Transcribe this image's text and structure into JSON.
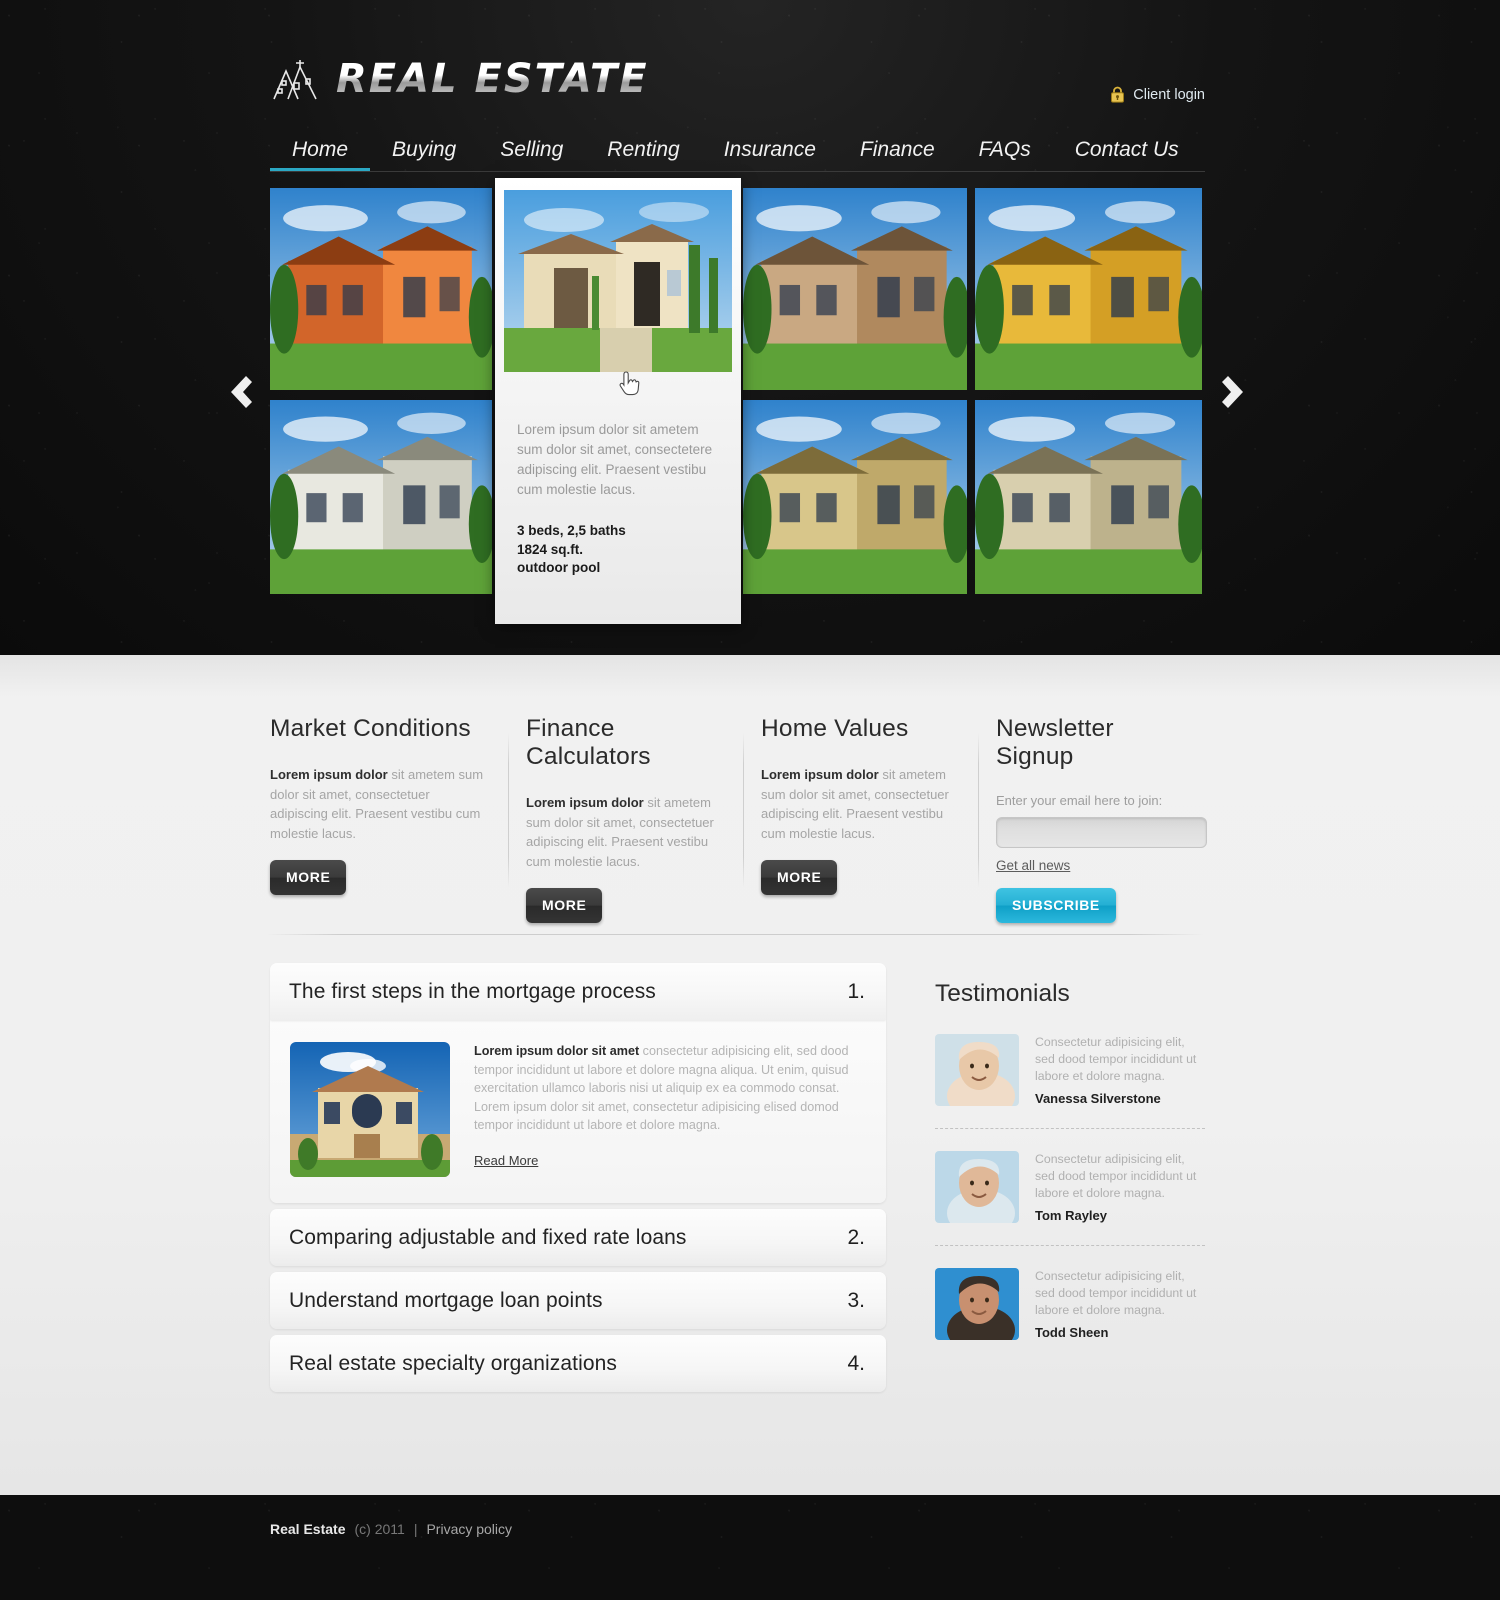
{
  "site": {
    "logo_text": "Real Estate",
    "logo_icon": "house-outline-icon"
  },
  "header": {
    "client_login_label": "Client login",
    "lock_icon": "lock-icon"
  },
  "nav": {
    "items": [
      {
        "label": "Home",
        "active": true
      },
      {
        "label": "Buying",
        "active": false
      },
      {
        "label": "Selling",
        "active": false
      },
      {
        "label": "Renting",
        "active": false
      },
      {
        "label": "Insurance",
        "active": false
      },
      {
        "label": "Finance",
        "active": false
      },
      {
        "label": "FAQs",
        "active": false
      },
      {
        "label": "Contact Us",
        "active": false
      }
    ],
    "active_underline_color": "#2ba8c4"
  },
  "slider": {
    "prev_icon": "chevron-left-icon",
    "next_icon": "chevron-right-icon",
    "cursor_icon": "pointing-hand-cursor-icon"
  },
  "popup": {
    "description": "Lorem ipsum dolor sit ametem sum dolor sit amet, consectetere adipiscing elit. Praesent vestibu cum molestie lacus.",
    "specs": [
      "3 beds,  2,5 baths",
      "1824 sq.ft.",
      "outdoor pool"
    ]
  },
  "columns": [
    {
      "title": "Market Conditions",
      "lead": "Lorem ipsum dolor",
      "body": " sit ametem sum dolor sit amet, consectetuer adipiscing elit. Praesent vestibu cum molestie lacus.",
      "button": "MORE"
    },
    {
      "title": "Finance Calculators",
      "lead": "Lorem ipsum dolor",
      "body": " sit ametem sum dolor sit amet, consectetuer adipiscing elit. Praesent vestibu cum molestie lacus.",
      "button": "MORE"
    },
    {
      "title": "Home Values",
      "lead": "Lorem ipsum dolor",
      "body": " sit ametem sum dolor sit amet, consectetuer adipiscing elit. Praesent vestibu cum molestie lacus.",
      "button": "MORE"
    }
  ],
  "newsletter": {
    "title": "Newsletter  Signup",
    "label": "Enter your email here to join:",
    "input_value": "",
    "input_placeholder": "",
    "link": "Get all news",
    "button": "SUBSCRIBE",
    "button_color": "#1fb0d4"
  },
  "accordion": {
    "open": {
      "title": "The first steps in the mortgage process",
      "number": "1.",
      "lead": "Lorem ipsum dolor sit amet",
      "body": " consectetur adipisicing elit, sed dood tempor incididunt ut labore et dolore magna aliqua. Ut enim, quisud exercitation ullamco laboris nisi ut aliquip ex ea commodo consat. Lorem ipsum dolor sit amet, consectetur adipisicing elised domod tempor incididunt ut labore et dolore magna.",
      "read_more": "Read More"
    },
    "items": [
      {
        "title": "Comparing adjustable and fixed rate loans",
        "number": "2."
      },
      {
        "title": "Understand mortgage loan points",
        "number": "3."
      },
      {
        "title": "Real estate specialty organizations",
        "number": "4."
      }
    ]
  },
  "testimonials": {
    "title": "Testimonials",
    "items": [
      {
        "quote": "Consectetur adipisicing elit, sed dood tempor incididunt ut labore et dolore magna.",
        "name": "Vanessa Silverstone"
      },
      {
        "quote": "Consectetur adipisicing elit, sed dood tempor incididunt ut labore et dolore magna.",
        "name": "Tom Rayley"
      },
      {
        "quote": "Consectetur adipisicing elit, sed dood tempor incididunt ut labore et dolore magna.",
        "name": "Todd Sheen"
      }
    ]
  },
  "footer": {
    "brand": "Real Estate",
    "copyright": "(c) 2011",
    "separator": "|",
    "privacy": "Privacy policy"
  }
}
